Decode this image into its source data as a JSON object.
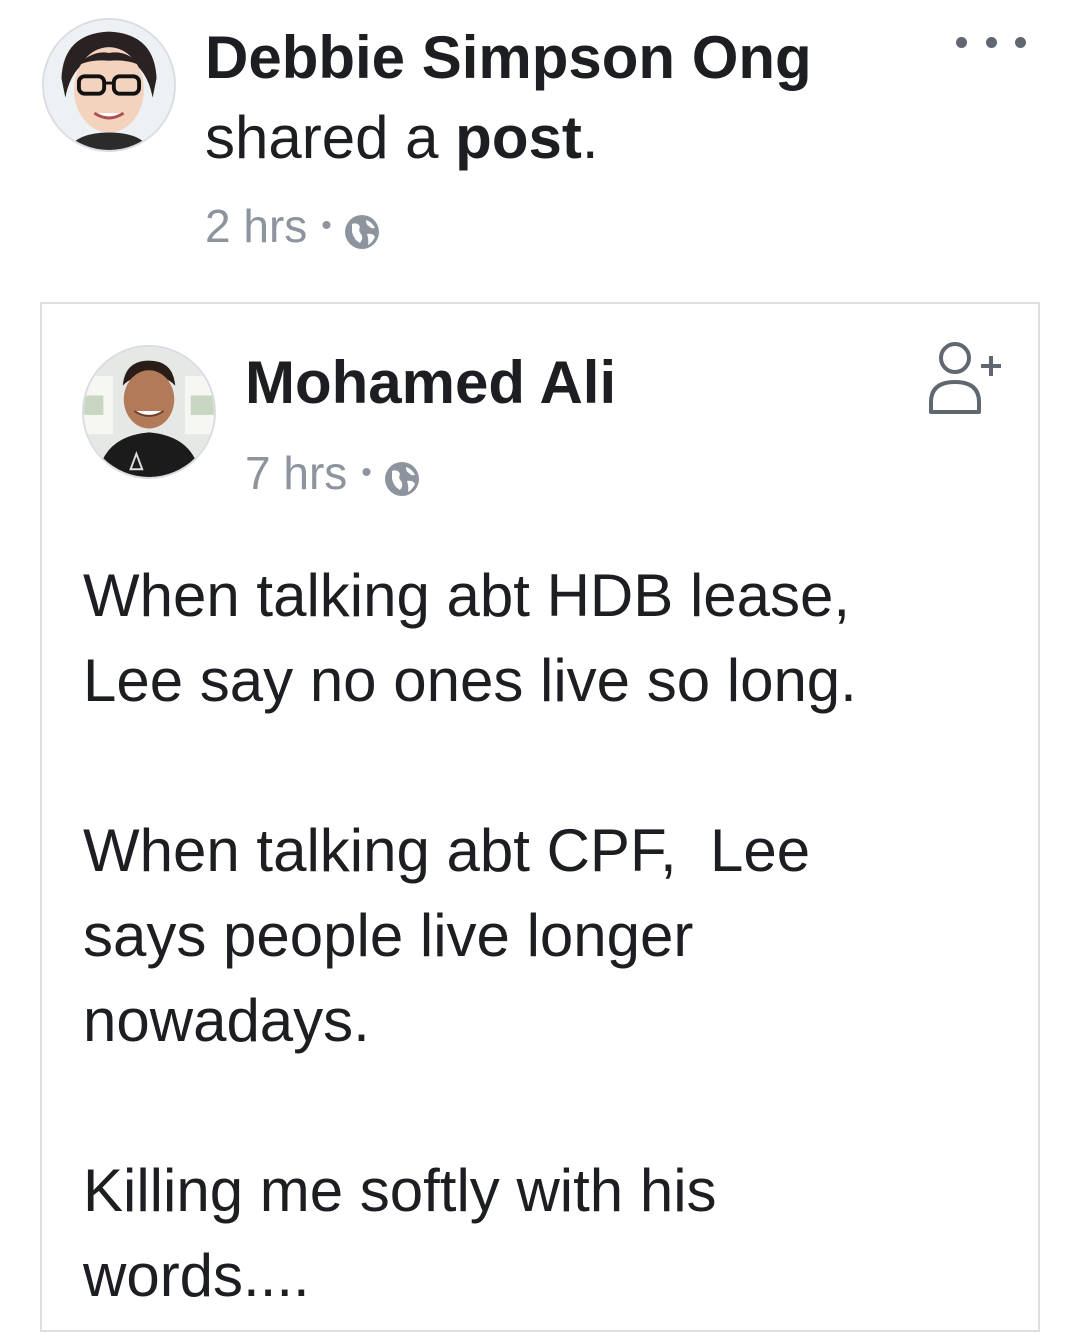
{
  "share_header": {
    "sharer_name": "Debbie Simpson Ong",
    "shared_verb": "shared a",
    "shared_object": "post",
    "shared_suffix": ".",
    "timestamp": "2 hrs",
    "separator": "•",
    "privacy_icon": "globe-icon",
    "more_icon": "more-options-icon"
  },
  "shared_post": {
    "author_name": "Mohamed Ali",
    "timestamp": "7 hrs",
    "separator": "•",
    "privacy_icon": "globe-icon",
    "action_icon": "add-friend-icon",
    "paragraphs": [
      "When talking abt HDB lease,\nLee say no ones live so long.",
      "When talking abt CPF,  Lee\nsays people live longer\nnowadays.",
      "Killing me softly with his\nwords...."
    ]
  },
  "colors": {
    "primary_text": "#1c1e21",
    "secondary_text": "#8d949e",
    "icon": "#606770",
    "card_border": "#dddfe2"
  }
}
